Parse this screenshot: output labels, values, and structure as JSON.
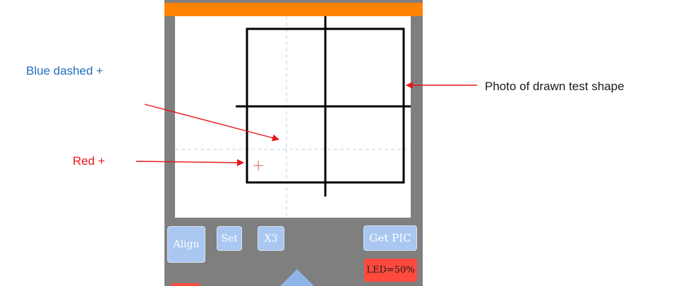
{
  "annotations": {
    "blue_dashed": "Blue dashed +",
    "red": "Red +",
    "photo": "Photo of drawn test shape"
  },
  "buttons": {
    "align": "Align",
    "set": "Set",
    "x3": "X3",
    "get_pic": "Get PIC"
  },
  "led_status": "LED=50%",
  "colors": {
    "topbar": "#ff8200",
    "frame": "#7f7f7f",
    "button": "#a9c7f0",
    "led": "#ff4a3d",
    "annotation_blue": "#1f6fbf",
    "annotation_red": "#e8141a",
    "arrow": "#e8141a"
  }
}
